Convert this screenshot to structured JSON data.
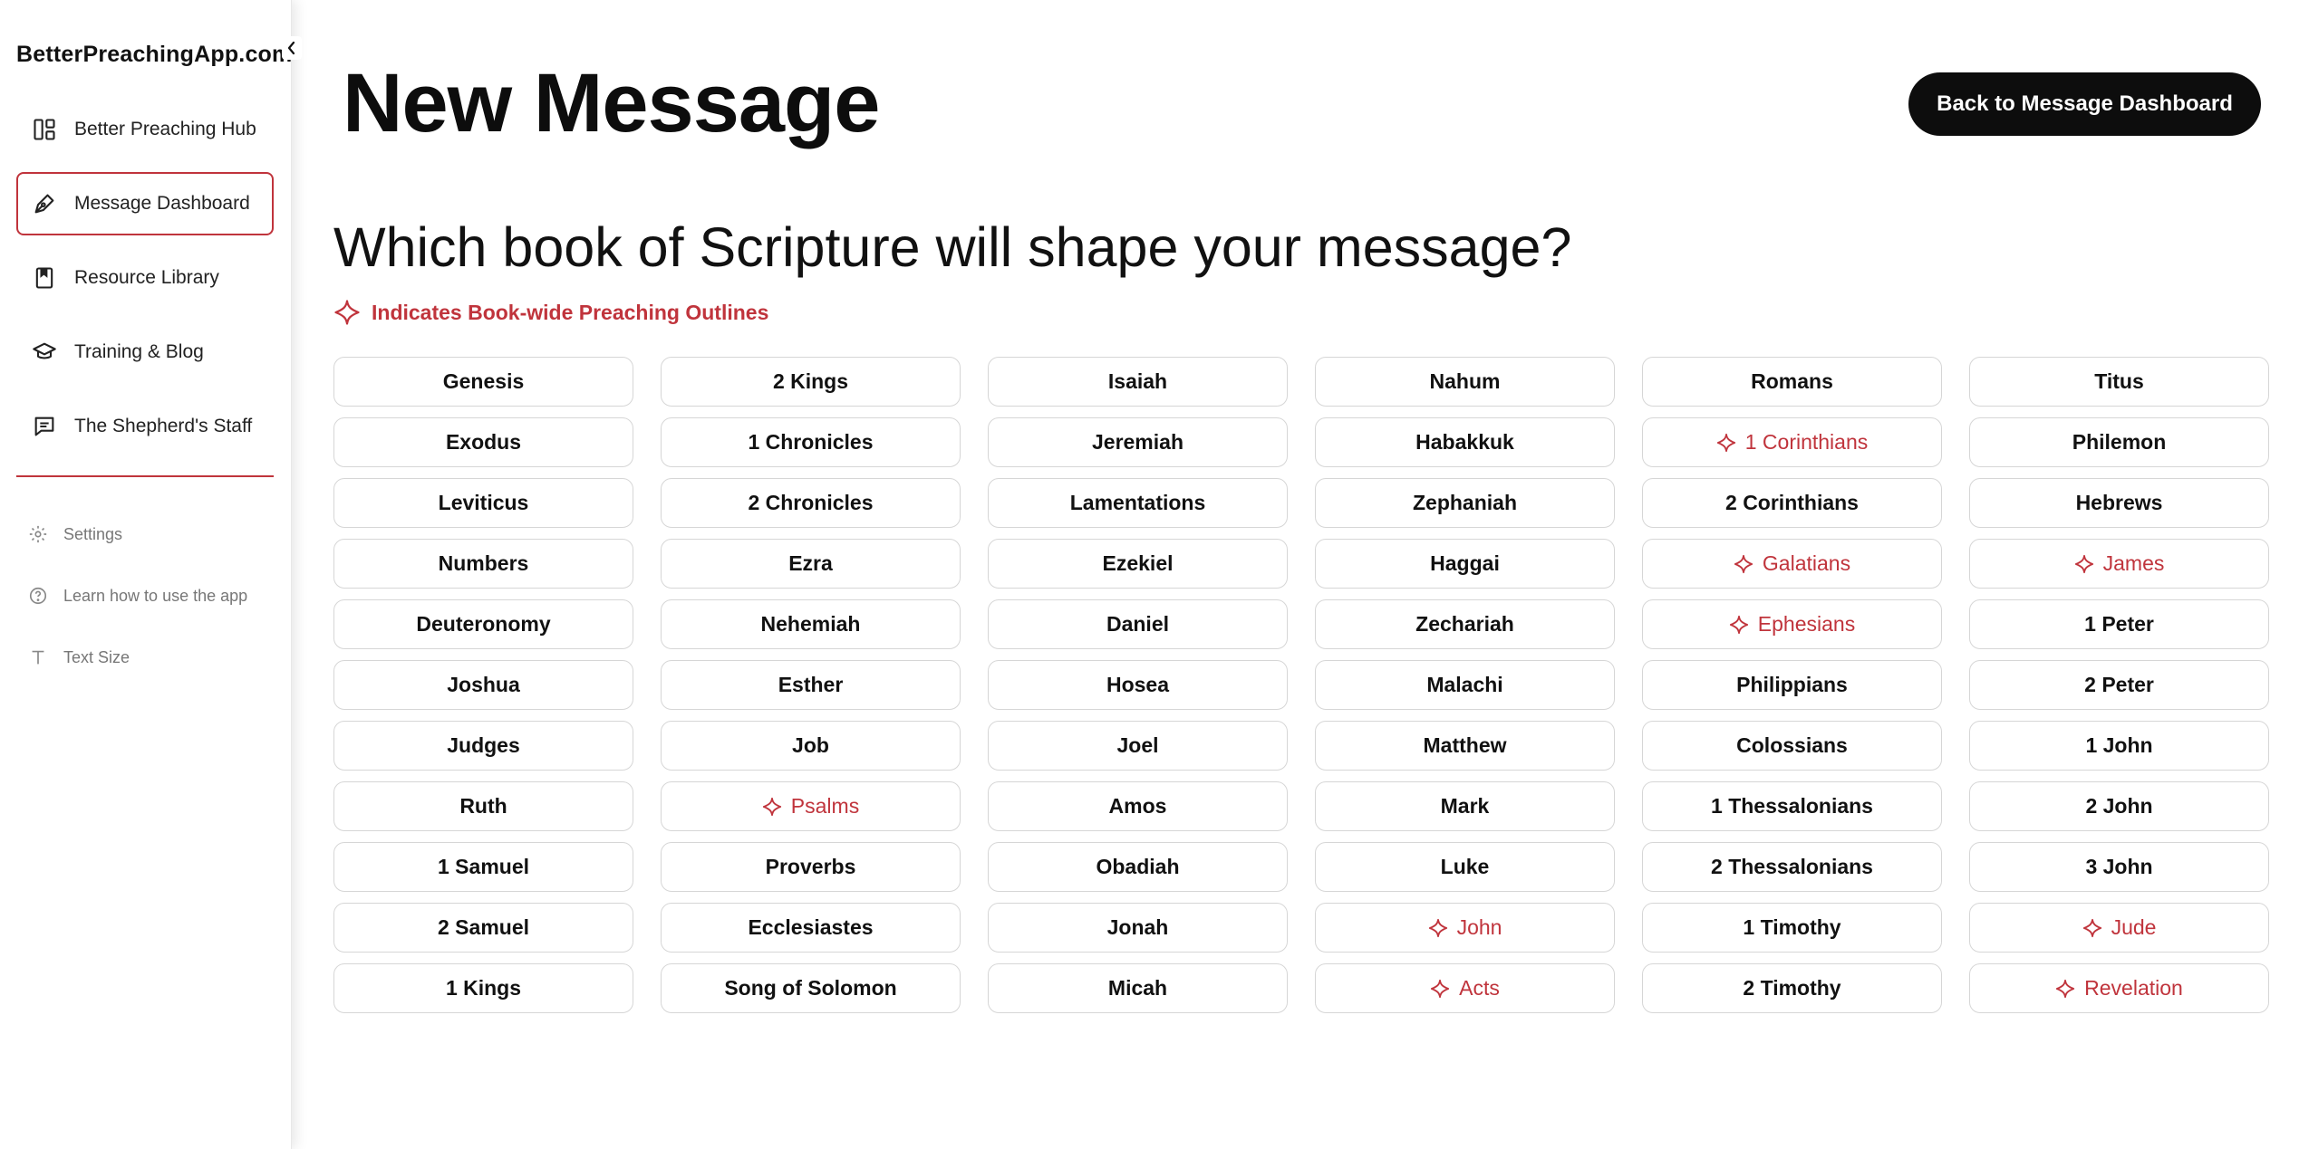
{
  "brand": "BetterPreachingApp.com",
  "colors": {
    "accent": "#c0343c",
    "button_bg": "#0d0d0d"
  },
  "sidebar": {
    "nav": [
      {
        "label": "Better Preaching Hub",
        "icon": "dashboard-icon"
      },
      {
        "label": "Message Dashboard",
        "icon": "pen-icon",
        "active": true
      },
      {
        "label": "Resource Library",
        "icon": "bookmark-book-icon"
      },
      {
        "label": "Training & Blog",
        "icon": "graduation-cap-icon"
      },
      {
        "label": "The Shepherd's Staff",
        "icon": "message-icon"
      }
    ],
    "sub": [
      {
        "label": "Settings",
        "icon": "gear-icon"
      },
      {
        "label": "Learn how to use the app",
        "icon": "help-circle-icon"
      },
      {
        "label": "Text Size",
        "icon": "text-size-icon"
      }
    ]
  },
  "header": {
    "title": "New Message",
    "back_label": "Back to Message Dashboard"
  },
  "question": "Which book of Scripture will shape your message?",
  "legend": "Indicates Book-wide Preaching Outlines",
  "books": [
    {
      "name": "Genesis"
    },
    {
      "name": "Exodus"
    },
    {
      "name": "Leviticus"
    },
    {
      "name": "Numbers"
    },
    {
      "name": "Deuteronomy"
    },
    {
      "name": "Joshua"
    },
    {
      "name": "Judges"
    },
    {
      "name": "Ruth"
    },
    {
      "name": "1 Samuel"
    },
    {
      "name": "2 Samuel"
    },
    {
      "name": "1 Kings"
    },
    {
      "name": "2 Kings"
    },
    {
      "name": "1 Chronicles"
    },
    {
      "name": "2 Chronicles"
    },
    {
      "name": "Ezra"
    },
    {
      "name": "Nehemiah"
    },
    {
      "name": "Esther"
    },
    {
      "name": "Job"
    },
    {
      "name": "Psalms",
      "outline": true
    },
    {
      "name": "Proverbs"
    },
    {
      "name": "Ecclesiastes"
    },
    {
      "name": "Song of Solomon"
    },
    {
      "name": "Isaiah"
    },
    {
      "name": "Jeremiah"
    },
    {
      "name": "Lamentations"
    },
    {
      "name": "Ezekiel"
    },
    {
      "name": "Daniel"
    },
    {
      "name": "Hosea"
    },
    {
      "name": "Joel"
    },
    {
      "name": "Amos"
    },
    {
      "name": "Obadiah"
    },
    {
      "name": "Jonah"
    },
    {
      "name": "Micah"
    },
    {
      "name": "Nahum"
    },
    {
      "name": "Habakkuk"
    },
    {
      "name": "Zephaniah"
    },
    {
      "name": "Haggai"
    },
    {
      "name": "Zechariah"
    },
    {
      "name": "Malachi"
    },
    {
      "name": "Matthew"
    },
    {
      "name": "Mark"
    },
    {
      "name": "Luke"
    },
    {
      "name": "John",
      "outline": true
    },
    {
      "name": "Acts",
      "outline": true
    },
    {
      "name": "Romans"
    },
    {
      "name": "1 Corinthians",
      "outline": true
    },
    {
      "name": "2 Corinthians"
    },
    {
      "name": "Galatians",
      "outline": true
    },
    {
      "name": "Ephesians",
      "outline": true
    },
    {
      "name": "Philippians"
    },
    {
      "name": "Colossians"
    },
    {
      "name": "1 Thessalonians"
    },
    {
      "name": "2 Thessalonians"
    },
    {
      "name": "1 Timothy"
    },
    {
      "name": "2 Timothy"
    },
    {
      "name": "Titus"
    },
    {
      "name": "Philemon"
    },
    {
      "name": "Hebrews"
    },
    {
      "name": "James",
      "outline": true
    },
    {
      "name": "1 Peter"
    },
    {
      "name": "2 Peter"
    },
    {
      "name": "1 John"
    },
    {
      "name": "2 John"
    },
    {
      "name": "3 John"
    },
    {
      "name": "Jude",
      "outline": true
    },
    {
      "name": "Revelation",
      "outline": true
    }
  ]
}
